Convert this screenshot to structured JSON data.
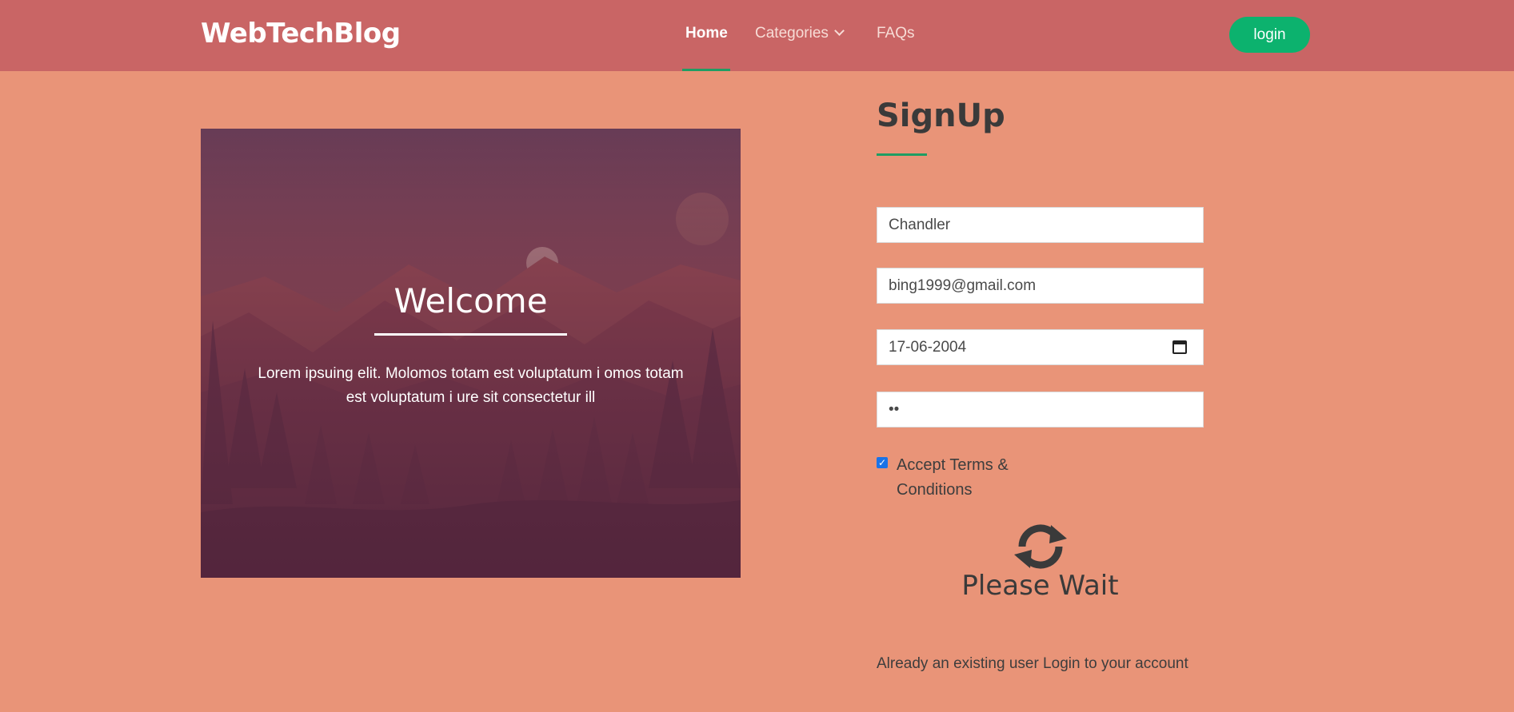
{
  "navbar": {
    "brand": "WebTechBlog",
    "items": [
      {
        "label": "Home"
      },
      {
        "label": "Categories"
      },
      {
        "label": "FAQs"
      }
    ],
    "login_label": "login"
  },
  "hero": {
    "title": "Welcome",
    "text": "Lorem ipsuing elit. Molomos totam est voluptatum i omos totam est voluptatum i ure sit consectetur ill"
  },
  "form": {
    "title": "SignUp",
    "name_value": "Chandler",
    "email_value": "bing1999@gmail.com",
    "date_value": "17-06-2004",
    "password_value": "••",
    "terms_label": "Accept Terms & Conditions",
    "terms_checked": true,
    "wait_text": "Please Wait",
    "existing_user_text": "Already an existing user Login to your account"
  },
  "icons": {
    "dropdown": "chevron-down-icon",
    "calendar": "calendar-icon",
    "spinner": "sync-icon",
    "checkbox": "checkmark-icon"
  },
  "colors": {
    "navbar": "#c96565",
    "background": "#e99478",
    "accent": "#0cb26e",
    "underline": "#1f9d63"
  }
}
